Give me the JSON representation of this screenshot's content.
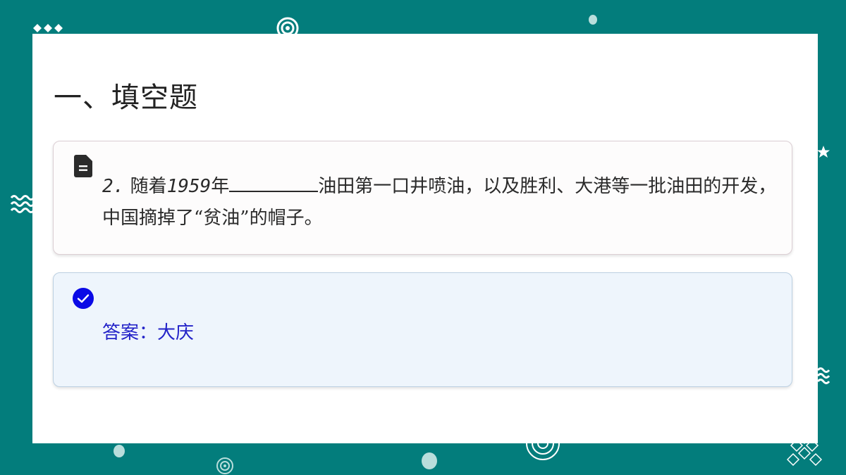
{
  "slide": {
    "title": "一、填空题"
  },
  "question": {
    "icon": "document-icon",
    "number": "2.",
    "text_before_year": "随着",
    "year": "1959",
    "text_before_blank": "年",
    "text_after_blank": "油田第一口井喷油，以及胜利、大港等一批油田的开发，中国摘掉了“贫油”的帽子。"
  },
  "answer": {
    "icon": "check-circle-icon",
    "text": "答案：大庆"
  },
  "colors": {
    "background": "#037d7c",
    "slide": "#ffffff",
    "question_card": "#fdfcfc",
    "answer_card": "#eef5fc",
    "answer_text": "#2323c8",
    "check_icon": "#0a0ae6"
  }
}
